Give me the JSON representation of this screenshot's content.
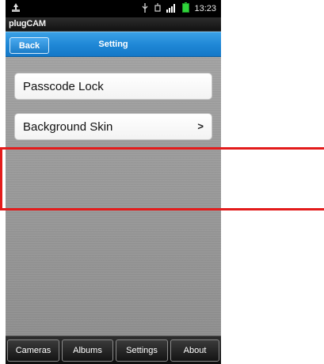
{
  "status_bar": {
    "time": "13:23",
    "icons": [
      "recycle-icon",
      "usb-icon",
      "alarm-icon",
      "signal-icon",
      "battery-icon"
    ]
  },
  "app": {
    "title": "plugCAM"
  },
  "nav": {
    "back_label": "Back",
    "title": "Setting"
  },
  "menu": {
    "items": [
      {
        "label": "Passcode Lock",
        "chevron": ""
      },
      {
        "label": "Background Skin",
        "chevron": ">"
      }
    ]
  },
  "tabs": [
    {
      "label": "Cameras"
    },
    {
      "label": "Albums"
    },
    {
      "label": "Settings"
    },
    {
      "label": "About"
    }
  ],
  "colors": {
    "accent_blue": "#1e86d5",
    "highlight_red": "#e31b1b",
    "battery_green": "#2fd43a"
  }
}
